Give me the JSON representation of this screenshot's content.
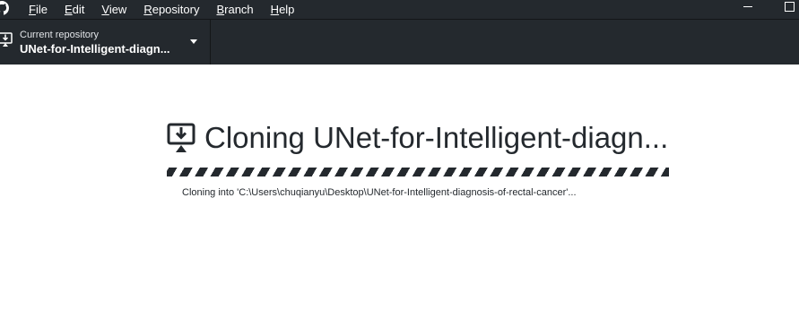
{
  "menu": {
    "items": [
      {
        "mnemonic": "F",
        "rest": "ile"
      },
      {
        "mnemonic": "E",
        "rest": "dit"
      },
      {
        "mnemonic": "V",
        "rest": "iew"
      },
      {
        "mnemonic": "R",
        "rest": "epository"
      },
      {
        "mnemonic": "B",
        "rest": "ranch"
      },
      {
        "mnemonic": "H",
        "rest": "elp"
      }
    ]
  },
  "toolbar": {
    "repo_caption": "Current repository",
    "repo_name": "UNet-for-Intelligent-diagn..."
  },
  "main": {
    "clone_title": "Cloning UNet-for-Intelligent-diagn...",
    "clone_status": "Cloning into 'C:\\Users\\chuqianyu\\Desktop\\UNet-for-Intelligent-diagnosis-of-rectal-cancer'..."
  },
  "icons": {
    "app_logo": "github-icon",
    "repo": "clone-icon",
    "dropdown": "chevron-down-icon",
    "minimize": "minimize-icon",
    "maximize": "maximize-icon"
  },
  "colors": {
    "chrome_background": "#24292e",
    "text_primary": "#24292e",
    "background": "#ffffff"
  }
}
